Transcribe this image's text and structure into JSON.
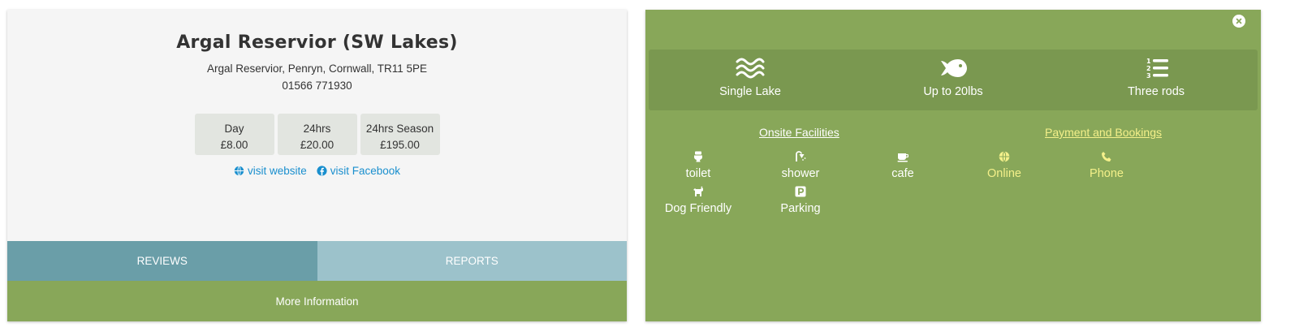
{
  "venue": {
    "title": "Argal Reservior (SW Lakes)",
    "address": "Argal Reservior, Penryn, Cornwall, TR11 5PE",
    "phone": "01566 771930"
  },
  "prices": [
    {
      "label": "Day",
      "price": "£8.00"
    },
    {
      "label": "24hrs",
      "price": "£20.00"
    },
    {
      "label": "24hrs Season",
      "price": "£195.00"
    }
  ],
  "links": {
    "website": "visit website",
    "facebook": "visit Facebook"
  },
  "tabs": {
    "reviews": "REVIEWS",
    "reports": "REPORTS"
  },
  "more_info": "More Information",
  "features": [
    {
      "icon": "water-icon",
      "label": "Single Lake"
    },
    {
      "icon": "fish-icon",
      "label": "Up to 20lbs"
    },
    {
      "icon": "numbered-list-icon",
      "label": "Three rods"
    }
  ],
  "sections": {
    "facilities": "Onsite Facilities",
    "payment": "Payment and Bookings"
  },
  "facilities": [
    {
      "icon": "toilet-icon",
      "label": "toilet"
    },
    {
      "icon": "shower-icon",
      "label": "shower"
    },
    {
      "icon": "coffee-cup-icon",
      "label": "cafe"
    },
    {
      "icon": "dog-icon",
      "label": "Dog Friendly"
    },
    {
      "icon": "parking-icon",
      "label": "Parking"
    }
  ],
  "payments": [
    {
      "icon": "globe-icon",
      "label": "Online"
    },
    {
      "icon": "phone-icon",
      "label": "Phone"
    }
  ],
  "colors": {
    "green": "#88a759",
    "green_dark": "#7a9850",
    "teal": "#6a9ea8",
    "teal_light": "#9cc2cb",
    "link_blue": "#1a8fce",
    "payment_yellow": "#f4f08a"
  }
}
